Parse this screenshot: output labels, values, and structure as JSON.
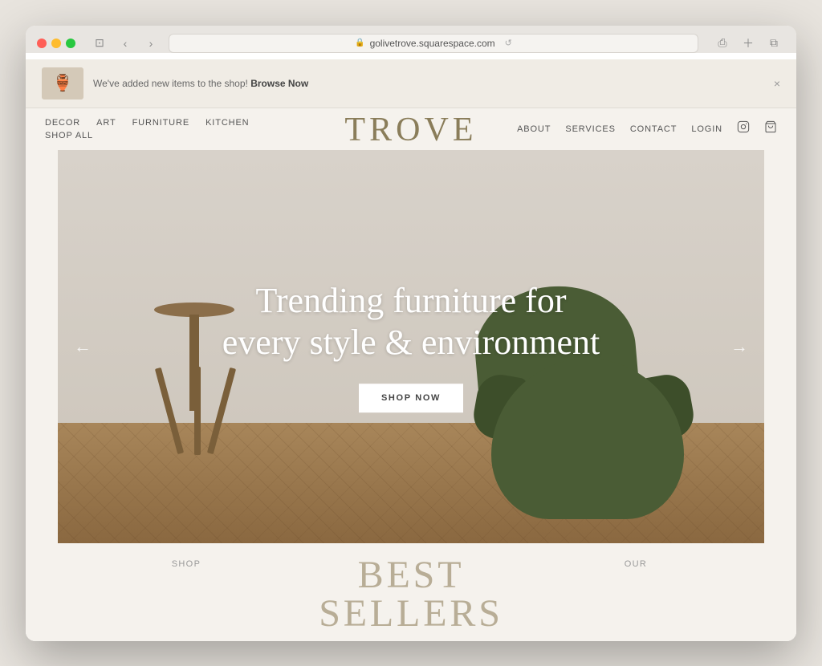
{
  "browser": {
    "url": "golivetrove.squarespace.com",
    "tab_title": "TROVE"
  },
  "announcement": {
    "text": "We've added new items to the shop!",
    "cta": "Browse Now",
    "close_label": "×"
  },
  "nav": {
    "left_row1": [
      "DECOR",
      "ART",
      "FURNITURE",
      "KITCHEN"
    ],
    "left_row2": [
      "SHOP ALL"
    ],
    "site_title": "TROVE",
    "right_links": [
      "ABOUT",
      "SERVICES",
      "CONTACT",
      "LOGIN"
    ]
  },
  "hero": {
    "heading_line1": "Trending furniture for",
    "heading_line2": "every style & environment",
    "cta_label": "SHOP NOW",
    "arrow_left": "←",
    "arrow_right": "→"
  },
  "below": {
    "col1_label": "SHOP",
    "col2_heading1": "BEST",
    "col2_heading2": "SELLERS",
    "col3_label": "OUR"
  }
}
